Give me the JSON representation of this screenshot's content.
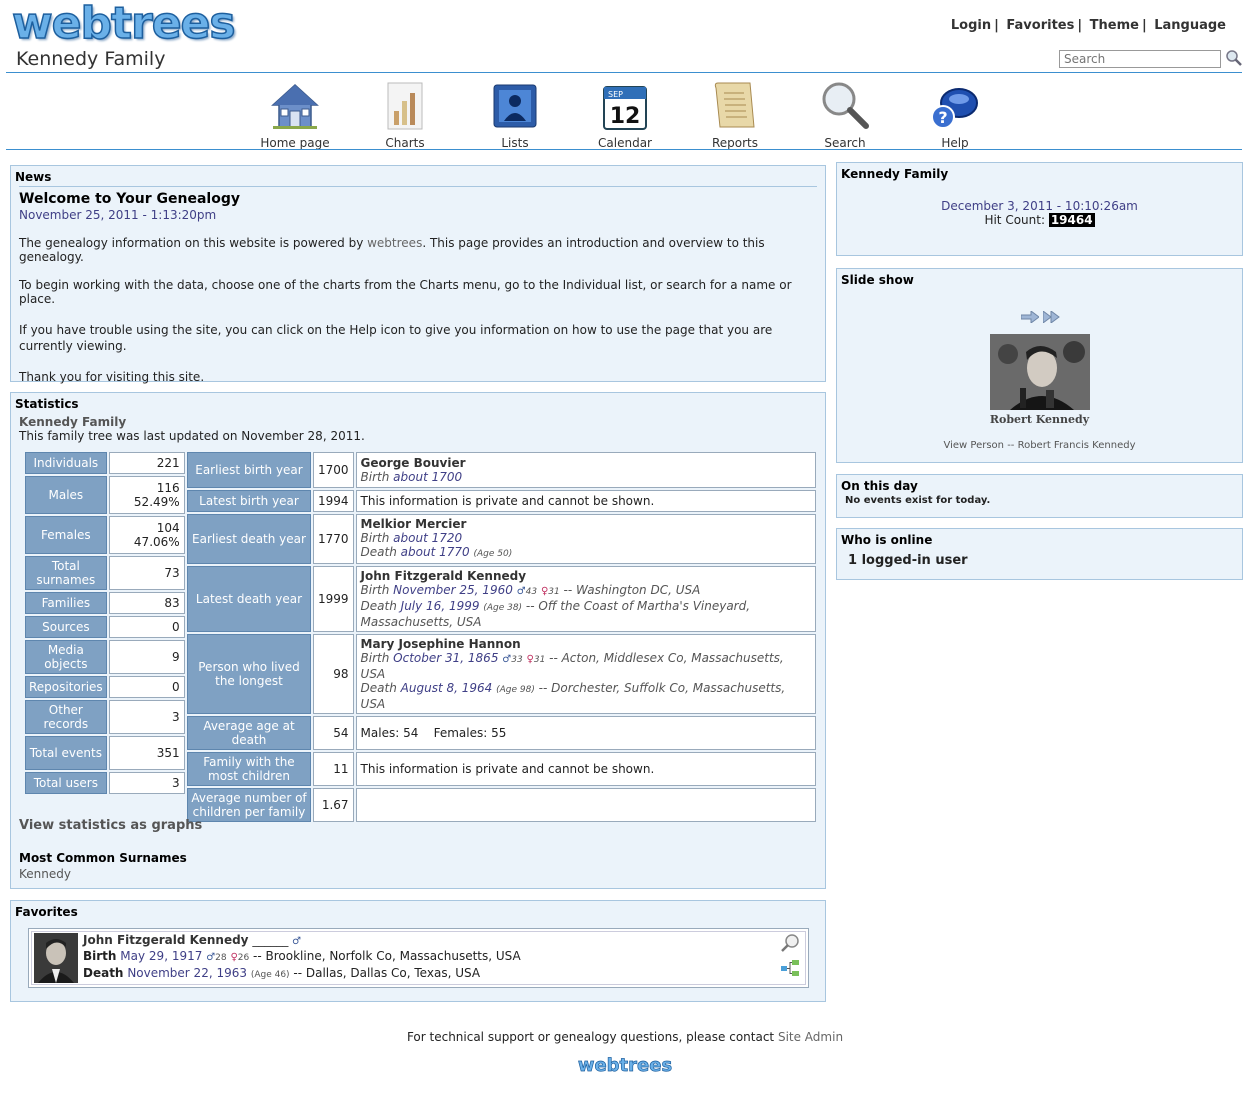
{
  "header": {
    "logo": "webtrees",
    "site_title": "Kennedy Family",
    "menu": [
      "Login",
      "Favorites",
      "Theme",
      "Language"
    ],
    "search_placeholder": "Search"
  },
  "mainmenu": [
    {
      "label": "Home page",
      "icon": "home-icon"
    },
    {
      "label": "Charts",
      "icon": "charts-icon"
    },
    {
      "label": "Lists",
      "icon": "lists-icon"
    },
    {
      "label": "Calendar",
      "icon": "calendar-icon",
      "month": "SEP",
      "day": "12"
    },
    {
      "label": "Reports",
      "icon": "reports-icon"
    },
    {
      "label": "Search",
      "icon": "search-icon"
    },
    {
      "label": "Help",
      "icon": "help-icon"
    }
  ],
  "news": {
    "title": "News",
    "heading": "Welcome to Your Genealogy",
    "date": "November 25, 2011 - 1:13:20pm",
    "p1_pre": "The genealogy information on this website is powered by ",
    "p1_link": "webtrees",
    "p1_post": ". This page provides an introduction and overview to this genealogy.",
    "p2": "To begin working with the data, choose one of the charts from the Charts menu, go to the Individual list, or search for a name or place.",
    "p3": "If you have trouble using the site, you can click on the Help icon to give you information on how to use the page that you are currently viewing.",
    "p4": "Thank you for visiting this site."
  },
  "statistics": {
    "title": "Statistics",
    "tree_name": "Kennedy Family",
    "updated": "This family tree was last updated on November 28, 2011.",
    "left": [
      {
        "label": "Individuals",
        "value": "221"
      },
      {
        "label": "Males",
        "value": "116",
        "value2": "52.49%"
      },
      {
        "label": "Females",
        "value": "104",
        "value2": "47.06%"
      },
      {
        "label": "Total surnames",
        "value": "73"
      },
      {
        "label": "Families",
        "value": "83"
      },
      {
        "label": "Sources",
        "value": "0"
      },
      {
        "label": "Media objects",
        "value": "9"
      },
      {
        "label": "Repositories",
        "value": "0"
      },
      {
        "label": "Other records",
        "value": "3"
      },
      {
        "label": "Total events",
        "value": "351"
      },
      {
        "label": "Total users",
        "value": "3"
      }
    ],
    "right": {
      "earliest_birth": {
        "label": "Earliest birth year",
        "year": "1700",
        "name": "George Bouvier",
        "line1_pre": "Birth ",
        "line1_date": "about 1700"
      },
      "latest_birth": {
        "label": "Latest birth year",
        "year": "1994",
        "text": "This information is private and cannot be shown."
      },
      "earliest_death": {
        "label": "Earliest death year",
        "year": "1770",
        "name": "Melkior Mercier",
        "line1_pre": "Birth ",
        "line1_date": "about 1720",
        "line2_pre": "Death ",
        "line2_date": "about 1770",
        "line2_age": "(Age 50)"
      },
      "latest_death": {
        "label": "Latest death year",
        "year": "1999",
        "name": "John Fitzgerald Kennedy",
        "line1_pre": "Birth ",
        "line1_date": "November 25, 1960",
        "line1_m": "43",
        "line1_f": "31",
        "line1_place": " -- Washington DC, USA",
        "line2_pre": "Death ",
        "line2_date": "July 16, 1999",
        "line2_age": "(Age 38)",
        "line2_place": " -- Off the Coast of Martha's Vineyard, Massachusetts, USA"
      },
      "longest": {
        "label": "Person who lived the longest",
        "years": "98",
        "name": "Mary Josephine Hannon",
        "line1_pre": "Birth ",
        "line1_date": "October 31, 1865",
        "line1_m": "33",
        "line1_f": "31",
        "line1_place": " -- Acton, Middlesex Co, Massachusetts, USA",
        "line2_pre": "Death ",
        "line2_date": "August 8, 1964",
        "line2_age": "(Age 98)",
        "line2_place": " -- Dorchester, Suffolk Co, Massachusetts, USA"
      },
      "avg_age": {
        "label": "Average age at death",
        "value": "54",
        "text": "Males: 54    Females: 55"
      },
      "most_children": {
        "label": "Family with the most children",
        "value": "11",
        "text": "This information is private and cannot be shown."
      },
      "avg_children": {
        "label": "Average number of children per family",
        "value": "1.67",
        "text": ""
      }
    },
    "graphs_link": "View statistics as graphs",
    "surnames_title": "Most Common Surnames",
    "surnames": "Kennedy"
  },
  "favorites": {
    "title": "Favorites",
    "name": "John Fitzgerald Kennedy",
    "name_suffix": "______",
    "birth_label": "Birth",
    "birth_date": "May 29, 1917",
    "birth_m": "28",
    "birth_f": "26",
    "birth_place": " -- Brookline, Norfolk Co, Massachusetts, USA",
    "death_label": "Death",
    "death_date": "November 22, 1963",
    "death_age": "(Age 46)",
    "death_place": " -- Dallas, Dallas Co, Texas, USA"
  },
  "sidebar": {
    "tree": {
      "title": "Kennedy Family",
      "datetime": "December 3, 2011 - 10:10:26am",
      "hit_label": "Hit Count: ",
      "hit_count": "19464"
    },
    "slideshow": {
      "title": "Slide show",
      "caption": "Robert Kennedy",
      "link": "View Person -- Robert Francis Kennedy"
    },
    "onthisday": {
      "title": "On this day",
      "text": "No events exist for today."
    },
    "online": {
      "title": "Who is online",
      "text": "1 logged-in user"
    }
  },
  "footer": {
    "text": "For technical support or genealogy questions, please contact ",
    "link": "Site Admin",
    "logo": "webtrees"
  },
  "colors": {
    "accent": "#3b8fcf",
    "label_bg": "#7fa1c3",
    "block_bg": "#ebf3fa",
    "link": "#3f3f86"
  }
}
